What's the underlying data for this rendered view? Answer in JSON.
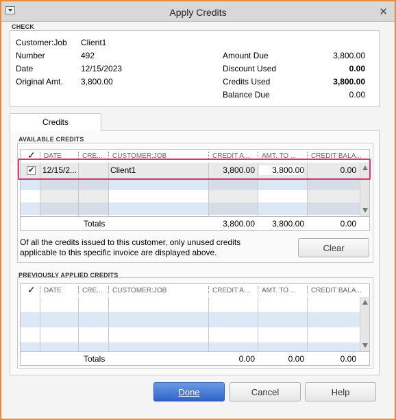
{
  "window": {
    "title": "Apply Credits"
  },
  "check": {
    "section_label": "CHECK",
    "customer_job_label": "Customer:Job",
    "customer_job_value": "Client1",
    "number_label": "Number",
    "number_value": "492",
    "date_label": "Date",
    "date_value": "12/15/2023",
    "original_amt_label": "Original Amt.",
    "original_amt_value": "3,800.00",
    "amount_due_label": "Amount Due",
    "amount_due_value": "3,800.00",
    "discount_used_label": "Discount Used",
    "discount_used_value": "0.00",
    "credits_used_label": "Credits Used",
    "credits_used_value": "3,800.00",
    "balance_due_label": "Balance Due",
    "balance_due_value": "0.00"
  },
  "tabs": {
    "credits": "Credits"
  },
  "columns": {
    "check": "✓",
    "date": "DATE",
    "credit_no": "CRE...",
    "customer_job": "CUSTOMER:JOB",
    "credit_amt": "CREDIT A...",
    "amt_to_use": "AMT. TO ...",
    "credit_balance": "CREDIT BALA..."
  },
  "available": {
    "section_label": "AVAILABLE CREDITS",
    "rows": [
      {
        "checked": true,
        "date": "12/15/2...",
        "credit_no": "",
        "customer_job": "Client1",
        "credit_amt": "3,800.00",
        "amt_to_use": "3,800.00",
        "credit_balance": "0.00"
      }
    ],
    "totals": {
      "label": "Totals",
      "credit_amt": "3,800.00",
      "amt_to_use": "3,800.00",
      "credit_balance": "0.00"
    },
    "note_line1": "Of all the credits issued to this customer, only unused credits",
    "note_line2": "applicable to this specific invoice are displayed above.",
    "clear_label": "Clear"
  },
  "previous": {
    "section_label": "PREVIOUSLY APPLIED CREDITS",
    "totals": {
      "label": "Totals",
      "credit_amt": "0.00",
      "amt_to_use": "0.00",
      "credit_balance": "0.00"
    }
  },
  "buttons": {
    "done": "Done",
    "cancel": "Cancel",
    "help": "Help"
  },
  "colors": {
    "accent_frame": "#e8883a",
    "highlight": "#e0356b",
    "primary_button": "#2f64c7",
    "stripe": "#dde8f7"
  }
}
